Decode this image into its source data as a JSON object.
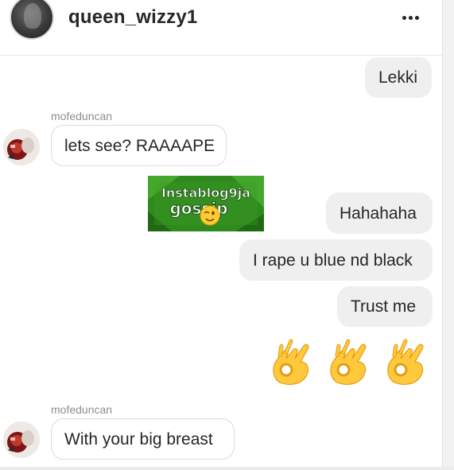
{
  "header": {
    "username": "queen_wizzy1",
    "more_icon": "more-horizontal-icon"
  },
  "messages": [
    {
      "type": "text",
      "direction": "outgoing",
      "text": "Lekki"
    },
    {
      "type": "text",
      "direction": "incoming",
      "sender": "mofeduncan",
      "text": "lets see? RAAAAPE"
    },
    {
      "type": "sticker",
      "direction": "incoming",
      "line1": "Instablog9ja",
      "line2": "gossip",
      "emoji": "winking-face"
    },
    {
      "type": "text",
      "direction": "outgoing",
      "text": "Hahahaha"
    },
    {
      "type": "text",
      "direction": "outgoing",
      "text": "I rape u blue nd black"
    },
    {
      "type": "text",
      "direction": "outgoing",
      "text": "Trust me"
    },
    {
      "type": "emoji",
      "direction": "outgoing",
      "emoji": "ok-hand",
      "count": 3
    },
    {
      "type": "text",
      "direction": "incoming",
      "sender": "mofeduncan",
      "text": "With your big breast"
    }
  ],
  "colors": {
    "outgoing_bubble": "#efefef",
    "incoming_border": "#dbdbdb",
    "sender_label": "#8e8e8e",
    "text": "#262626"
  }
}
